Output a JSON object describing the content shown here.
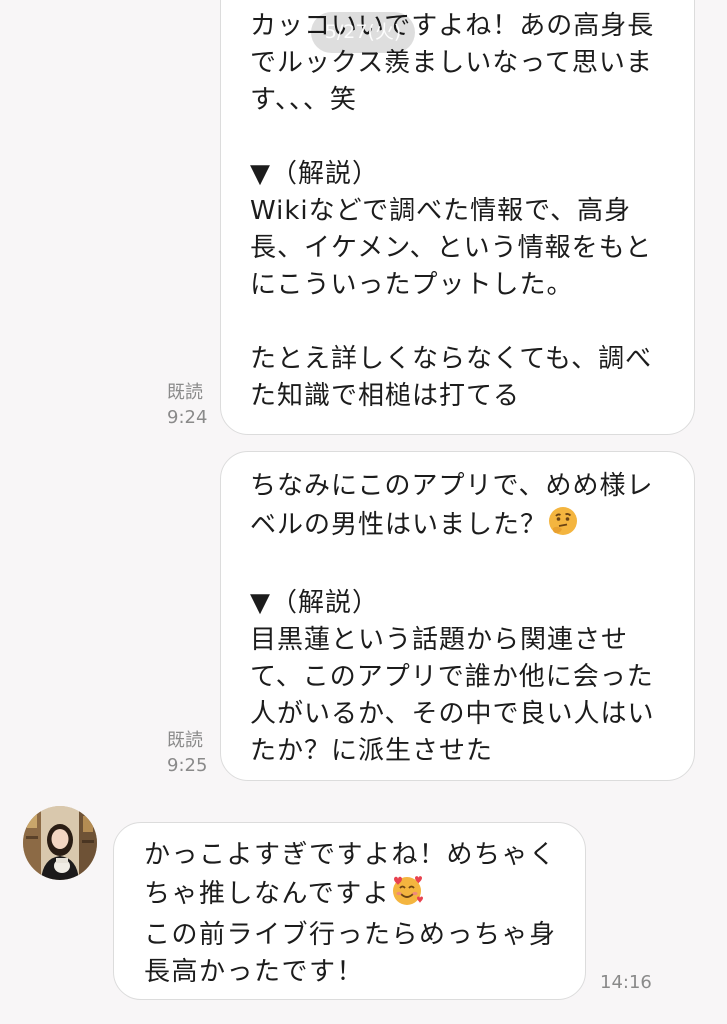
{
  "date_pill": "5/27(火)",
  "messages": [
    {
      "direction": "sent",
      "text": "カッコいいですよね！あの高身長でルックス羨ましいなって思います、、、笑\n\n▼（解説）\nWikiなどで調べた情報で、高身長、イケメン、という情報をもとにこういったプットした。\n\nたとえ詳しくならなくても、調べた知識で相槌は打てる",
      "read": "既読",
      "time": "9:24"
    },
    {
      "direction": "sent",
      "text_before_emoji": "ちなみにこのアプリで、めめ様レベルの男性はいました？",
      "emoji": "thinking-face-icon",
      "text_after_emoji": "\n\n▼（解説）\n目黒蓮という話題から関連させて、このアプリで誰か他に会った人がいるか、その中で良い人はいたか？に派生させた",
      "read": "既読",
      "time": "9:25"
    },
    {
      "direction": "received",
      "text_before_emoji": "かっこよすぎですよね！めちゃくちゃ推しなんですよ",
      "emoji": "smiling-face-with-hearts-icon",
      "text_after_emoji": "\nこの前ライブ行ったらめっちゃ身長高かったです！",
      "time": "14:16"
    }
  ],
  "colors": {
    "background": "#f8f6f7",
    "bubble": "#ffffff",
    "bubble_border": "#dcdcdc",
    "meta_text": "#8a8a8a",
    "emoji": "#f4b53f"
  }
}
